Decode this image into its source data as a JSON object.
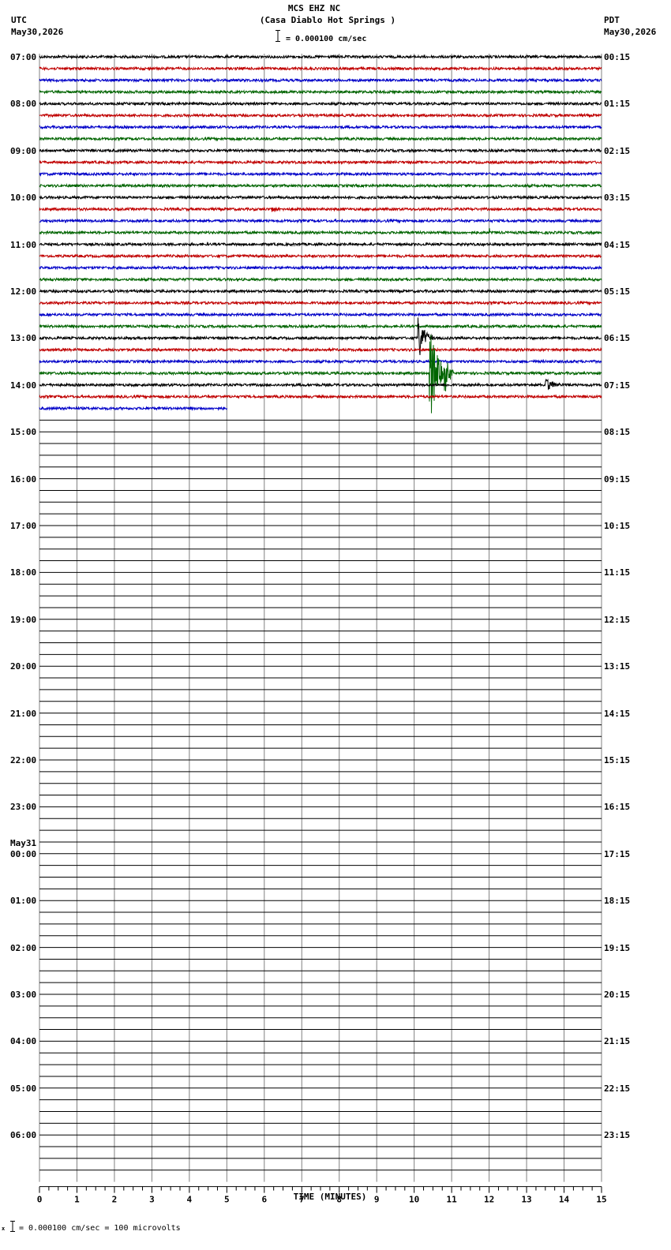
{
  "header": {
    "station": "MCS EHZ NC",
    "location": "(Casa Diablo Hot Springs )",
    "scale": "= 0.000100 cm/sec",
    "left_zone": "UTC",
    "left_date": "May30,2026",
    "right_zone": "PDT",
    "right_date": "May30,2026"
  },
  "footer": {
    "scale_note": "= 0.000100 cm/sec =     100 microvolts"
  },
  "chart_data": {
    "type": "line",
    "title": "MCS EHZ NC (Casa Diablo Hot Springs )",
    "xlabel": "TIME (MINUTES)",
    "xlim": [
      0,
      15
    ],
    "x_ticks": [
      "0",
      "1",
      "2",
      "3",
      "4",
      "5",
      "6",
      "7",
      "8",
      "9",
      "10",
      "11",
      "12",
      "13",
      "14",
      "15"
    ],
    "rows_per_hour": 4,
    "minutes_per_row": 15,
    "total_rows": 96,
    "trace_colors": [
      "#000000",
      "#c00000",
      "#0000c8",
      "#006400"
    ],
    "grid_color": "#808080",
    "utc_labels": [
      "07:00",
      "08:00",
      "09:00",
      "10:00",
      "11:00",
      "12:00",
      "13:00",
      "14:00",
      "15:00",
      "16:00",
      "17:00",
      "18:00",
      "19:00",
      "20:00",
      "21:00",
      "22:00",
      "23:00",
      "00:00",
      "01:00",
      "02:00",
      "03:00",
      "04:00",
      "05:00",
      "06:00"
    ],
    "day_change_label": "May31",
    "pdt_labels": [
      "00:15",
      "01:15",
      "02:15",
      "03:15",
      "04:15",
      "05:15",
      "06:15",
      "07:15",
      "08:15",
      "09:15",
      "10:15",
      "11:15",
      "12:15",
      "13:15",
      "14:15",
      "15:15",
      "16:15",
      "17:15",
      "18:15",
      "19:15",
      "20:15",
      "21:15",
      "22:15",
      "23:15"
    ],
    "recorded_rows": 31,
    "last_row_end_minute": 5,
    "events": [
      {
        "row": 13,
        "minute": 6.2,
        "amplitude": 5,
        "duration": 0.3
      },
      {
        "row": 15,
        "minute": 12.0,
        "amplitude": 8,
        "duration": 0.1
      },
      {
        "row": 24,
        "minute": 10.1,
        "amplitude": 30,
        "duration": 0.5
      },
      {
        "row": 27,
        "minute": 10.4,
        "amplitude": 70,
        "duration": 0.6
      },
      {
        "row": 27,
        "minute": 10.8,
        "amplitude": 28,
        "duration": 0.3
      },
      {
        "row": 28,
        "minute": 13.5,
        "amplitude": 10,
        "duration": 0.6
      }
    ]
  }
}
